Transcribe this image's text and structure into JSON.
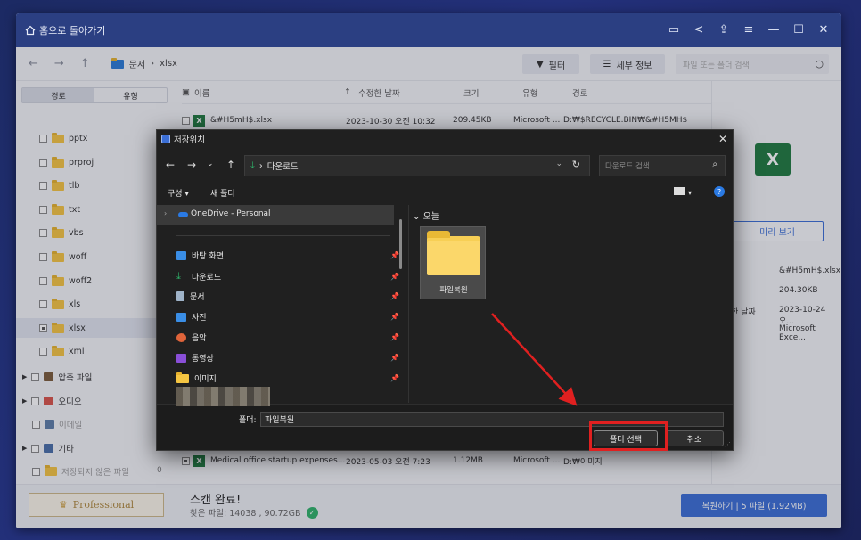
{
  "titlebar": {
    "home_label": "홈으로 돌아가기"
  },
  "navbar": {
    "crumbs": [
      "문서",
      "xlsx"
    ],
    "filter_label": "필터",
    "details_label": "세부 정보",
    "search_placeholder": "파일 또는 폴더 검색"
  },
  "sidebar": {
    "tabs": [
      "경로",
      "유형"
    ],
    "items": [
      {
        "label": "pptx",
        "count": "29"
      },
      {
        "label": "prproj"
      },
      {
        "label": "tlb"
      },
      {
        "label": "txt"
      },
      {
        "label": "vbs"
      },
      {
        "label": "woff"
      },
      {
        "label": "woff2"
      },
      {
        "label": "xls"
      },
      {
        "label": "xlsx",
        "selected": true
      },
      {
        "label": "xml"
      }
    ],
    "groups": [
      {
        "label": "압축 파일",
        "count": "6"
      },
      {
        "label": "오디오"
      },
      {
        "label": "이메일"
      },
      {
        "label": "기타",
        "count": "3"
      },
      {
        "label": "저장되지 않은 파일",
        "count": "0"
      }
    ]
  },
  "table": {
    "headers": [
      "이름",
      "수정한 날짜",
      "크기",
      "유형",
      "경로"
    ],
    "rows": [
      {
        "name": "&#H5mH$.xlsx",
        "date": "2023-10-30 오전 10:32",
        "size": "209.45KB",
        "type": "Microsoft ...",
        "path": "D:₩$RECYCLE.BIN₩&#H5MH$"
      },
      {
        "name": "Medical office startup expenses...",
        "date": "2023-05-03 오전 7:23",
        "size": "1.12MB",
        "type": "Microsoft ...",
        "path": "D:₩이미지"
      }
    ]
  },
  "preview": {
    "button_label": "미리 보기",
    "filename": "&#H5mH$.xlsx",
    "size": "204.30KB",
    "date_label": "한 날짜",
    "date": "2023-10-24 오...",
    "type": "Microsoft Exce..."
  },
  "bottom": {
    "pro_label": "Professional",
    "scan_title": "스캔 완료!",
    "scan_sub": "찾은 파일: 14038 , 90.72GB",
    "recover_label": "복원하기 | 5 파일 (1.92MB)"
  },
  "dialog": {
    "title": "저장위치",
    "address": "다운로드",
    "search_placeholder": "다운로드 검색",
    "organize_label": "구성 ▾",
    "new_folder_label": "새 폴더",
    "onedrive_label": "OneDrive - Personal",
    "quick_access": [
      {
        "label": "바탕 화면",
        "icon": "desktop-icon",
        "color": "#3a8ee6"
      },
      {
        "label": "다운로드",
        "icon": "download-icon",
        "color": "#2fb36a"
      },
      {
        "label": "문서",
        "icon": "document-icon",
        "color": "#9fb3c8"
      },
      {
        "label": "사진",
        "icon": "picture-icon",
        "color": "#3a8ee6"
      },
      {
        "label": "음악",
        "icon": "music-icon",
        "color": "#e0643a"
      },
      {
        "label": "동영상",
        "icon": "video-icon",
        "color": "#8a4fd8"
      },
      {
        "label": "이미지",
        "icon": "folder-icon",
        "color": "#f5c542"
      }
    ],
    "group_label": "오늘",
    "folder_name": "파일복원",
    "folder_field_label": "폴더:",
    "folder_field_value": "파일복원",
    "select_label": "폴더 선택",
    "cancel_label": "취소"
  },
  "colors": {
    "accent": "#3b6fd6",
    "titlebar": "#2b3f82",
    "highlight": "#e02020"
  }
}
